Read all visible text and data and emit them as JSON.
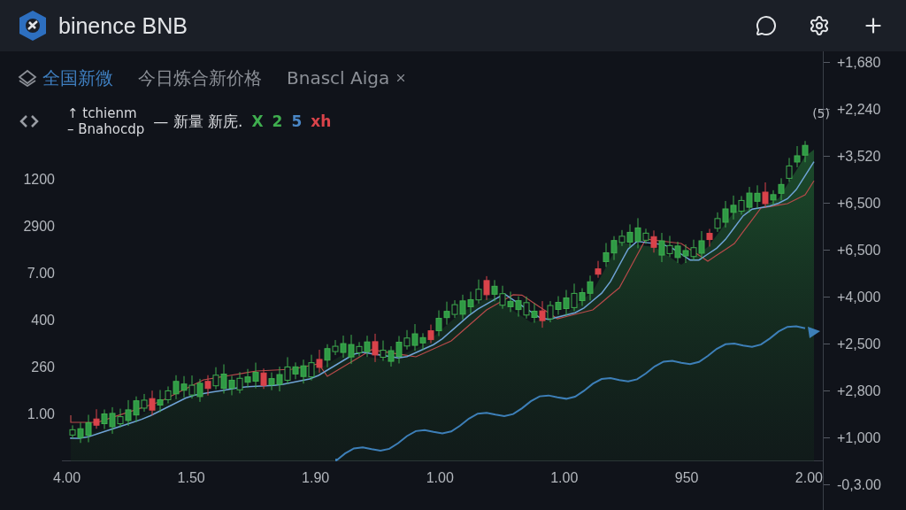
{
  "header": {
    "title": "binence BNB"
  },
  "tabs": [
    {
      "label": "全国新微",
      "selected": true
    },
    {
      "label": "今日炼合新价格",
      "selected": false
    },
    {
      "label": "Bnascl Aiga",
      "selected": false
    }
  ],
  "legend": {
    "lines": [
      {
        "marker": "↑",
        "text": "tchienm"
      },
      {
        "marker": "–",
        "text": "Bnahocdp"
      }
    ],
    "dash": "—",
    "label": "新量 新庑.",
    "values": [
      {
        "text": "X",
        "color": "#3fae4f"
      },
      {
        "text": "2",
        "color": "#3fae4f"
      },
      {
        "text": "5",
        "color": "#4a86c5"
      },
      {
        "text": "xh",
        "color": "#d9434a"
      }
    ]
  },
  "chart": {
    "last_label": "(5)",
    "left_axis": [
      "1200",
      "2900",
      "7.00",
      "400",
      "260",
      "1.00"
    ],
    "right_axis": [
      "+1,680",
      "+2,240",
      "+3,520",
      "+6,500",
      "+6,500",
      "+4,000",
      "+2,500",
      "+2,800",
      "+1,000",
      "-0,3.00"
    ],
    "x_axis": [
      "4.00",
      "1.50",
      "1.90",
      "1.00",
      "1.00",
      "950",
      "2.00"
    ]
  }
}
